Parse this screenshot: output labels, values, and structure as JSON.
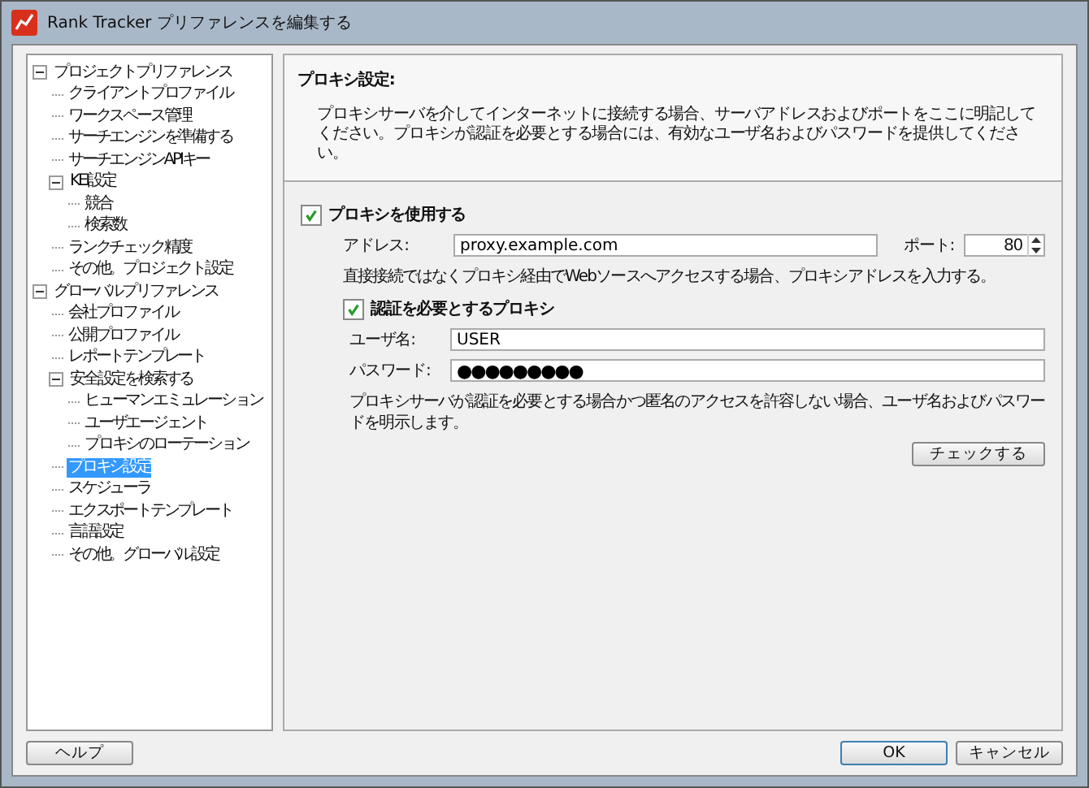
{
  "window": {
    "title": "Rank Tracker プリファレンスを編集する"
  },
  "tree": [
    {
      "label": "プロジェクトプリファレンス",
      "selected": false,
      "expanded": true,
      "children": [
        {
          "label": "クライアントプロファイル",
          "selected": false
        },
        {
          "label": "ワークスペース管理",
          "selected": false
        },
        {
          "label": "サーチエンジンを準備する",
          "selected": false
        },
        {
          "label": "サーチエンジンAPIキー",
          "selected": false
        },
        {
          "label": "KEI設定",
          "selected": false,
          "expanded": true,
          "children": [
            {
              "label": "競合",
              "selected": false
            },
            {
              "label": "検索数",
              "selected": false
            }
          ]
        },
        {
          "label": "ランクチェック精度",
          "selected": false
        },
        {
          "label": "その他。プロジェクト設定",
          "selected": false
        }
      ]
    },
    {
      "label": "グローバルプリファレンス",
      "selected": false,
      "expanded": true,
      "children": [
        {
          "label": "会社プロファイル",
          "selected": false
        },
        {
          "label": "公開プロファイル",
          "selected": false
        },
        {
          "label": "レポートテンプレート",
          "selected": false
        },
        {
          "label": "安全設定を検索する",
          "selected": false,
          "expanded": true,
          "children": [
            {
              "label": "ヒューマンエミュレーション",
              "selected": false
            },
            {
              "label": "ユーザエージェント",
              "selected": false
            },
            {
              "label": "プロキシのローテーション",
              "selected": false
            }
          ]
        },
        {
          "label": "プロキシ設定",
          "selected": true
        },
        {
          "label": "スケジューラ",
          "selected": false
        },
        {
          "label": "エクスポートテンプレート",
          "selected": false
        },
        {
          "label": "言語設定",
          "selected": false
        },
        {
          "label": "その他。グローバル設定",
          "selected": false
        }
      ]
    }
  ],
  "panel": {
    "title": "プロキシ設定:",
    "description": "プロキシサーバを介してインターネットに接続する場合、サーバアドレスおよびポートをここに明記してください。プロキシが認証を必要とする場合には、有効なユーザ名およびパスワードを提供してください。",
    "use_proxy": {
      "label": "プロキシを使用する",
      "checked": true
    },
    "address": {
      "label": "アドレス:",
      "value": "proxy.example.com"
    },
    "port": {
      "label": "ポート:",
      "value": "80"
    },
    "address_hint": "直接接続ではなくプロキシ経由でWebソースへアクセスする場合、プロキシアドレスを入力する。",
    "auth": {
      "label": "認証を必要とするプロキシ",
      "checked": true
    },
    "username": {
      "label": "ユーザ名:",
      "value": "USER"
    },
    "password": {
      "label": "パスワード:",
      "value": "●●●●●●●●●"
    },
    "auth_hint": "プロキシサーバが認証を必要とする場合かつ匿名のアクセスを許容しない場合、ユーザ名およびパスワードを明示します。",
    "check_button": "チェックする"
  },
  "buttons": {
    "help": "ヘルプ",
    "ok": "OK",
    "cancel": "キャンセル"
  }
}
